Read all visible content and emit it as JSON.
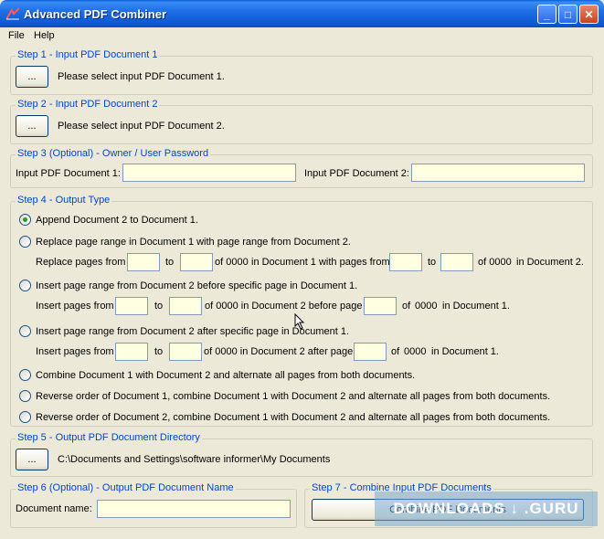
{
  "window": {
    "title": "Advanced PDF Combiner",
    "controls": [
      "_",
      "□",
      "✕"
    ]
  },
  "menu": [
    "File",
    "Help"
  ],
  "step1": {
    "legend": "Step 1 - Input PDF Document 1",
    "browse_label": "...",
    "status": "Please select input PDF Document 1."
  },
  "step2": {
    "legend": "Step 2 - Input PDF Document 2",
    "browse_label": "...",
    "status": "Please select input PDF Document 2."
  },
  "step3": {
    "legend": "Step 3 (Optional) - Owner / User Password",
    "doc1_label": "Input PDF Document 1:",
    "doc1_value": "",
    "doc2_label": "Input PDF Document 2:",
    "doc2_value": ""
  },
  "step4": {
    "legend": "Step 4 - Output Type",
    "options": [
      {
        "label": "Append Document 2 to Document 1.",
        "selected": true
      },
      {
        "label": "Replace page range in Document 1 with page range from Document 2.",
        "selected": false
      },
      {
        "label": "Insert page range from Document 2 before specific page in Document 1.",
        "selected": false
      },
      {
        "label": "Insert page range from Document 2 after specific page in Document 1.",
        "selected": false
      },
      {
        "label": "Combine Document 1 with Document 2 and alternate all pages from both documents.",
        "selected": false
      },
      {
        "label": "Reverse order of Document 1, combine Document 1 with Document 2 and alternate all pages from both documents.",
        "selected": false
      },
      {
        "label": "Reverse order of Document 2, combine Document 1 with Document 2 and alternate all pages from both documents.",
        "selected": false
      }
    ],
    "replace_row": {
      "replace_from": "Replace pages from",
      "to1": "to",
      "of1": "of 0000",
      "with_from": "in Document 1 with pages from",
      "to2": "to",
      "of2": "of 0000",
      "in_doc2": "in Document 2."
    },
    "insert_before_row": {
      "from": "Insert pages from",
      "to": "to",
      "of_doc2": "of 0000  in Document 2 before page",
      "of": "of",
      "count": "0000",
      "in_doc1": "in Document 1."
    },
    "insert_after_row": {
      "from": "Insert pages from",
      "to": "to",
      "of_doc2": "of 0000  in Document 2 after page",
      "of": "of",
      "count": "0000",
      "in_doc1": "in Document 1."
    }
  },
  "step5": {
    "legend": "Step 5 - Output PDF Document Directory",
    "browse_label": "...",
    "path": "C:\\Documents and Settings\\software informer\\My Documents"
  },
  "step6": {
    "legend": "Step 6 (Optional) - Output PDF Document Name",
    "name_label": "Document name:",
    "name_value": ""
  },
  "step7": {
    "legend": "Step 7 - Combine Input PDF Documents",
    "button_label": "Combine PDF Documents"
  },
  "watermark": "DOWNLOADS ↓ .GURU"
}
